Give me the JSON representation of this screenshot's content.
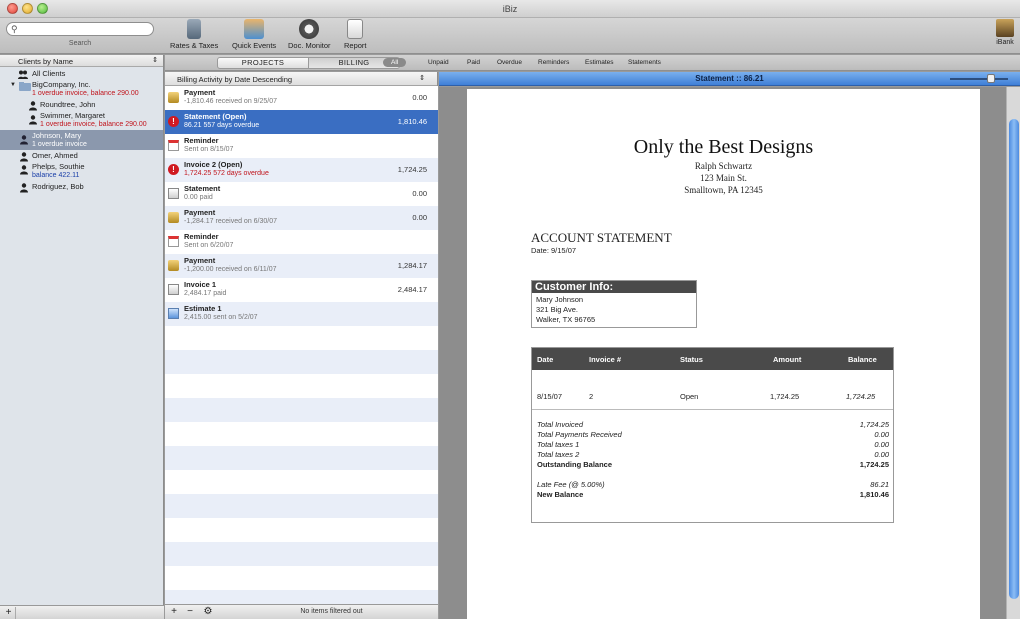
{
  "window": {
    "title": "iBiz"
  },
  "toolbar": {
    "search_placeholder": "",
    "search_label": "Search",
    "tools": [
      "Rates & Taxes",
      "Quick Events",
      "Doc. Monitor",
      "Report"
    ],
    "ibank_label": "iBank"
  },
  "sidebar": {
    "header": "Clients by Name",
    "clients": [
      {
        "name": "All Clients",
        "sub": ""
      },
      {
        "name": "BigCompany, Inc.",
        "sub": "1 overdue invoice, balance 290.00"
      },
      {
        "name": "Roundtree, John",
        "sub": ""
      },
      {
        "name": "Swimmer, Margaret",
        "sub": "1 overdue invoice, balance 290.00"
      },
      {
        "name": "Johnson, Mary",
        "sub": "1 overdue invoice"
      },
      {
        "name": "Omer, Ahmed",
        "sub": ""
      },
      {
        "name": "Phelps, Southie",
        "sub": "balance 422.11"
      },
      {
        "name": "Rodriguez, Bob",
        "sub": ""
      }
    ],
    "add_label": "+"
  },
  "tabs": {
    "projects": "PROJECTS",
    "billing": "BILLING",
    "filters": [
      "All",
      "Unpaid",
      "Paid",
      "Overdue",
      "Reminders",
      "Estimates",
      "Statements"
    ]
  },
  "billing": {
    "header": "Billing Activity by Date Descending",
    "rows": [
      {
        "title": "Payment",
        "sub": "-1,810.46 received on 9/25/07",
        "amount": "0.00"
      },
      {
        "title": "Statement (Open)",
        "sub": "86.21 557 days overdue",
        "amount": "1,810.46"
      },
      {
        "title": "Reminder",
        "sub": "Sent on 8/15/07",
        "amount": ""
      },
      {
        "title": "Invoice 2 (Open)",
        "sub": "1,724.25 572 days overdue",
        "amount": "1,724.25"
      },
      {
        "title": "Statement",
        "sub": "0.00 paid",
        "amount": "0.00"
      },
      {
        "title": "Payment",
        "sub": "-1,284.17 received on 6/30/07",
        "amount": "0.00"
      },
      {
        "title": "Reminder",
        "sub": "Sent on 6/20/07",
        "amount": ""
      },
      {
        "title": "Payment",
        "sub": "-1,200.00 received on 6/11/07",
        "amount": "1,284.17"
      },
      {
        "title": "Invoice 1",
        "sub": "2,484.17 paid",
        "amount": "2,484.17"
      },
      {
        "title": "Estimate 1",
        "sub": "2,415.00 sent on 5/2/07",
        "amount": ""
      }
    ],
    "status": "No items filtered out",
    "buttons": [
      "+",
      "−",
      "⚙"
    ]
  },
  "statement": {
    "bar_title": "Statement :: 86.21",
    "company": "Only the Best Designs",
    "contact": "Ralph Schwartz",
    "address1": "123 Main St.",
    "address2": "Smalltown, PA  12345",
    "doc_title": "ACCOUNT STATEMENT",
    "date": "Date: 9/15/07",
    "customer": {
      "heading": "Customer Info:",
      "name": "Mary Johnson",
      "street": "321 Big Ave.",
      "city": "Walker, TX  96765"
    },
    "table": {
      "headers": [
        "Date",
        "Invoice #",
        "Status",
        "Amount",
        "Balance"
      ],
      "row": [
        "8/15/07",
        "2",
        "Open",
        "1,724.25",
        "1,724.25"
      ]
    },
    "totals": [
      {
        "label": "Total Invoiced",
        "value": "1,724.25",
        "style": "it"
      },
      {
        "label": "Total Payments Received",
        "value": "0.00",
        "style": "it"
      },
      {
        "label": "Total taxes 1",
        "value": "0.00",
        "style": "it"
      },
      {
        "label": "Total taxes 2",
        "value": "0.00",
        "style": "it"
      },
      {
        "label": "Outstanding Balance",
        "value": "1,724.25",
        "style": "bd"
      },
      {
        "label": "",
        "value": "",
        "style": ""
      },
      {
        "label": "Late Fee (@ 5.00%)",
        "value": "86.21",
        "style": "it"
      },
      {
        "label": "New Balance",
        "value": "1,810.46",
        "style": "bd"
      }
    ]
  },
  "colors": {
    "accent": "#3a6ec2",
    "overdue": "#c0141c",
    "balance": "#1a3fa8"
  }
}
